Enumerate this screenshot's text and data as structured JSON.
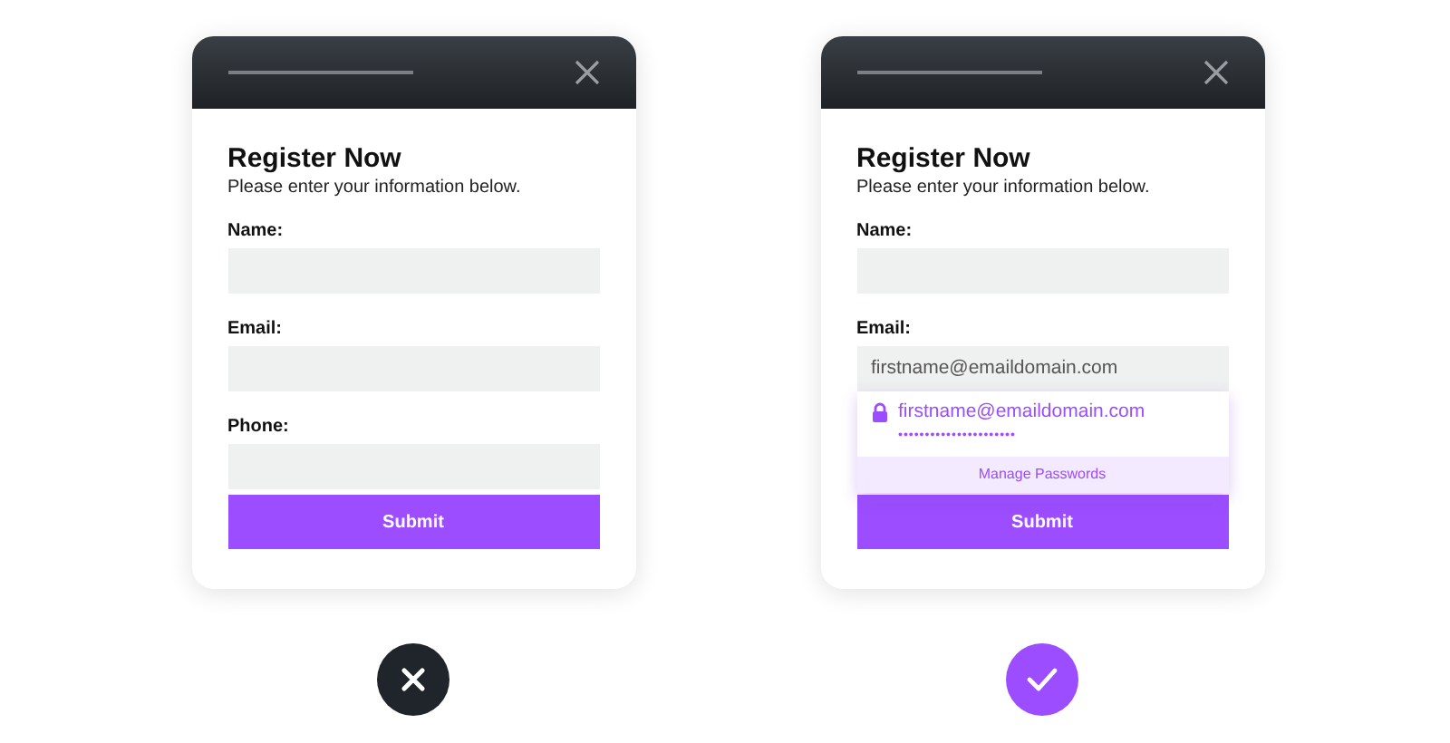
{
  "panels": [
    {
      "title": "Register Now",
      "subtitle": "Please enter your information below.",
      "fields": [
        {
          "label": "Name:"
        },
        {
          "label": "Email:"
        },
        {
          "label": "Phone:"
        }
      ],
      "submit": "Submit",
      "verdict": {
        "kind": "wrong"
      }
    },
    {
      "title": "Register Now",
      "subtitle": "Please enter your information below.",
      "fields": [
        {
          "label": "Name:"
        },
        {
          "label": "Email:",
          "value": "firstname@emaildomain.com",
          "suggestion": {
            "account": "firstname@emaildomain.com",
            "password": "••••••••••••••••••••••",
            "action": "Manage Passwords"
          }
        }
      ],
      "submit": "Submit",
      "verdict": {
        "kind": "right"
      }
    }
  ]
}
